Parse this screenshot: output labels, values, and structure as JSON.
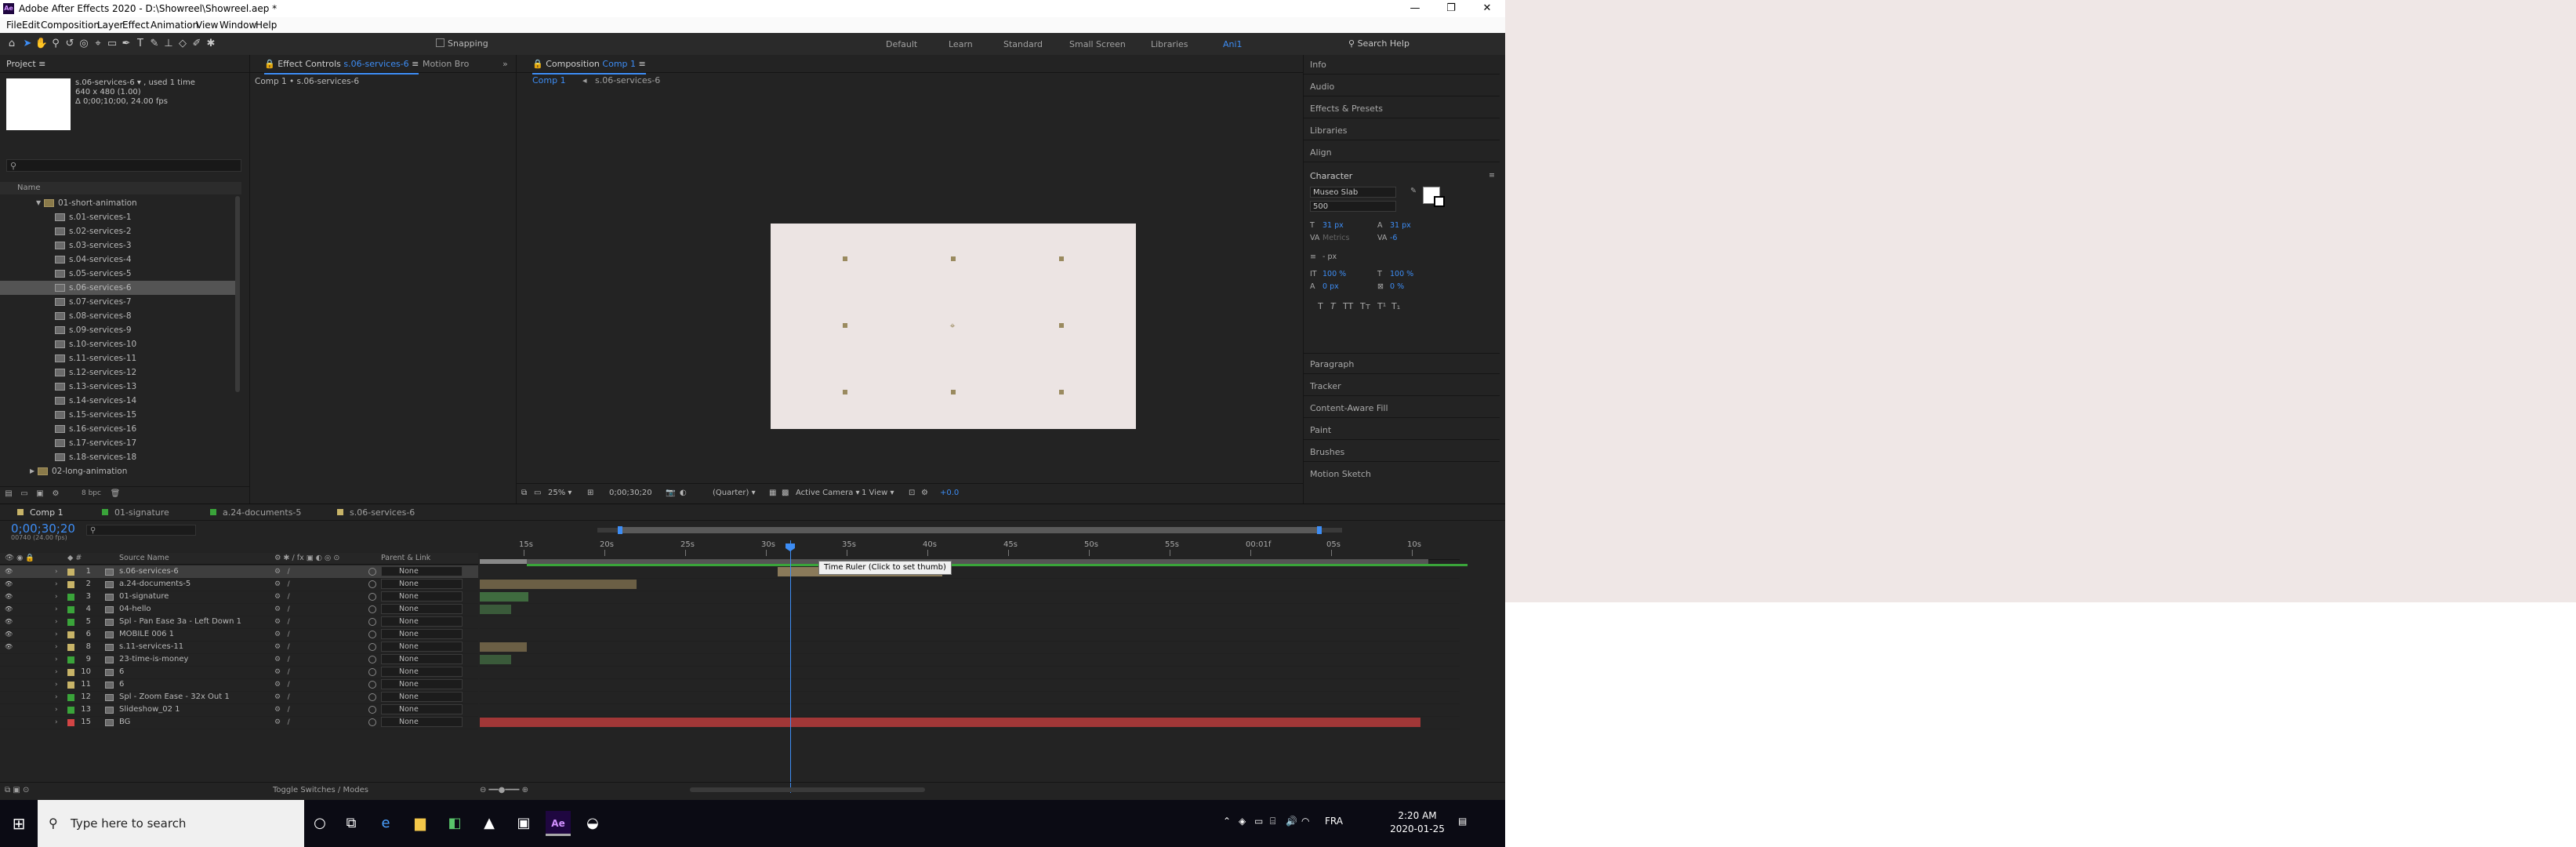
{
  "app": {
    "title": "Adobe After Effects 2020 - D:\\Showreel\\Showreel.aep *",
    "icon_label": "Ae",
    "window_controls": [
      "—",
      "❐",
      "✕"
    ]
  },
  "menu": [
    "File",
    "Edit",
    "Composition",
    "Layer",
    "Effect",
    "Animation",
    "View",
    "Window",
    "Help"
  ],
  "toolbar": {
    "snapping_label": "Snapping",
    "workspaces": [
      "Default",
      "Learn",
      "Standard",
      "Small Screen",
      "Libraries",
      "Ani1"
    ],
    "current_workspace": "Ani1",
    "search_placeholder": "Search Help"
  },
  "project": {
    "tab_label": "Project",
    "selected_name": "s.06-services-6",
    "used": ", used 1 time",
    "size": "640 x 480 (1.00)",
    "duration": "Δ 0;00;10;00, 24.00 fps",
    "name_header": "Name",
    "folder_open": "01-short-animation",
    "items": [
      "s.01-services-1",
      "s.02-services-2",
      "s.03-services-3",
      "s.04-services-4",
      "s.05-services-5",
      "s.06-services-6",
      "s.07-services-7",
      "s.08-services-8",
      "s.09-services-9",
      "s.10-services-10",
      "s.11-services-11",
      "s.12-services-12",
      "s.13-services-13",
      "s.14-services-14",
      "s.15-services-15",
      "s.16-services-16",
      "s.17-services-17",
      "s.18-services-18"
    ],
    "folder_closed": "02-long-animation",
    "bpc": "8 bpc"
  },
  "effect_controls": {
    "tab_prefix": "Effect Controls",
    "tab_target": "s.06-services-6",
    "motion_tab": "Motion Bro",
    "crumb": "Comp 1 • s.06-services-6"
  },
  "composition": {
    "tab_prefix": "Composition",
    "tab_target": "Comp 1",
    "subtabs": [
      "Comp 1",
      "s.06-services-6"
    ],
    "zoom": "25%",
    "timecode": "0;00;30;20",
    "quality": "(Quarter)",
    "camera": "Active Camera",
    "views": "1 View",
    "exposure": "+0.0"
  },
  "right_panels": {
    "top": [
      "Info",
      "Audio",
      "Effects & Presets",
      "Libraries",
      "Align"
    ],
    "character": {
      "title": "Character",
      "font": "Museo Slab",
      "style": "500",
      "size": "31 px",
      "leading": "31 px",
      "kerning": "Metrics",
      "tracking": "-6",
      "stroke": "- px",
      "vscale": "100 %",
      "hscale": "100 %",
      "baseline": "0 px",
      "tsume": "0 %",
      "styles": [
        "T",
        "T",
        "TT",
        "Tт",
        "T¹",
        "T₁"
      ]
    },
    "bottom": [
      "Paragraph",
      "Tracker",
      "Content-Aware Fill",
      "Paint",
      "Brushes",
      "Motion Sketch"
    ]
  },
  "timeline": {
    "tabs": [
      "Comp 1",
      "01-signature",
      "a.24-documents-5",
      "s.06-services-6"
    ],
    "tab_colors": [
      "#c8b468",
      "#3aa43a",
      "#3aa43a",
      "#c8b468"
    ],
    "timecode": "0;00;30;20",
    "fps": "00740 (24.00 fps)",
    "col_source": "Source Name",
    "col_parent": "Parent & Link",
    "ruler": [
      "15s",
      "20s",
      "25s",
      "30s",
      "35s",
      "40s",
      "45s",
      "50s",
      "55s",
      "00:01f",
      "05s",
      "10s"
    ],
    "tooltip": "Time Ruler (Click to set thumb)",
    "toggle_label": "Toggle Switches / Modes",
    "layers": [
      {
        "n": "1",
        "name": "s.06-services-6",
        "color": "#c8b468",
        "parent": "None"
      },
      {
        "n": "2",
        "name": "a.24-documents-5",
        "color": "#c8b468",
        "parent": "None"
      },
      {
        "n": "3",
        "name": "01-signature",
        "color": "#3aa43a",
        "parent": "None"
      },
      {
        "n": "4",
        "name": "04-hello",
        "color": "#3aa43a",
        "parent": "None"
      },
      {
        "n": "5",
        "name": "Spl - Pan Ease 3a - Left Down 1",
        "color": "#3aa43a",
        "parent": "None"
      },
      {
        "n": "6",
        "name": "MOBILE 006 1",
        "color": "#c8b468",
        "parent": "None"
      },
      {
        "n": "8",
        "name": "s.11-services-11",
        "color": "#c8b468",
        "parent": "None"
      },
      {
        "n": "9",
        "name": "23-time-is-money",
        "color": "#3aa43a",
        "parent": "None"
      },
      {
        "n": "10",
        "name": "6",
        "color": "#c8b468",
        "parent": "None"
      },
      {
        "n": "11",
        "name": "6",
        "color": "#c8b468",
        "parent": "None"
      },
      {
        "n": "12",
        "name": "Spl - Zoom Ease - 32x Out 1",
        "color": "#3aa43a",
        "parent": "None"
      },
      {
        "n": "13",
        "name": "Slideshow_02 1",
        "color": "#3aa43a",
        "parent": "None"
      },
      {
        "n": "15",
        "name": "BG",
        "color": "#d24545",
        "parent": "None"
      }
    ]
  },
  "taskbar": {
    "search_placeholder": "Type here to search",
    "lang": "FRA",
    "time": "2:20 AM",
    "date": "2020-01-25"
  },
  "colors": {
    "accent": "#3d8df5",
    "panel": "#232323",
    "canvas": "#ece4e3",
    "desktop": "#efe7e6"
  }
}
